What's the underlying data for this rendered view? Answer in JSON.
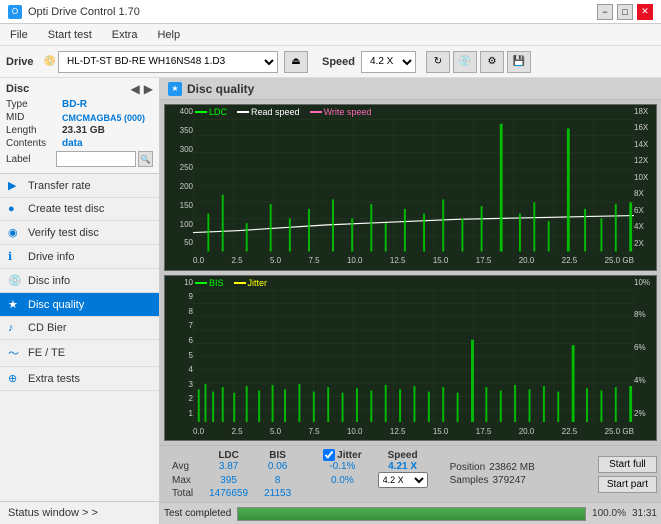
{
  "app": {
    "title": "Opti Drive Control 1.70",
    "icon": "O"
  },
  "titlebar": {
    "minimize_label": "−",
    "maximize_label": "□",
    "close_label": "✕"
  },
  "menubar": {
    "items": [
      "File",
      "Start test",
      "Extra",
      "Help"
    ]
  },
  "drivebar": {
    "drive_label": "Drive",
    "drive_value": "(G:) HL-DT-ST BD-RE  WH16NS48 1.D3",
    "speed_label": "Speed",
    "speed_value": "4.2 X"
  },
  "disc": {
    "section_label": "Disc",
    "type_label": "Type",
    "type_value": "BD-R",
    "mid_label": "MID",
    "mid_value": "CMCMAGBA5 (000)",
    "length_label": "Length",
    "length_value": "23.31 GB",
    "contents_label": "Contents",
    "contents_value": "data",
    "label_label": "Label",
    "label_placeholder": ""
  },
  "nav": {
    "items": [
      {
        "id": "transfer-rate",
        "label": "Transfer rate",
        "icon": "▶"
      },
      {
        "id": "create-test-disc",
        "label": "Create test disc",
        "icon": "●"
      },
      {
        "id": "verify-test-disc",
        "label": "Verify test disc",
        "icon": "◉"
      },
      {
        "id": "drive-info",
        "label": "Drive info",
        "icon": "ℹ"
      },
      {
        "id": "disc-info",
        "label": "Disc info",
        "icon": "💿"
      },
      {
        "id": "disc-quality",
        "label": "Disc quality",
        "icon": "★",
        "active": true
      },
      {
        "id": "cd-bier",
        "label": "CD Bier",
        "icon": "🎵"
      },
      {
        "id": "fe-te",
        "label": "FE / TE",
        "icon": "〜"
      },
      {
        "id": "extra-tests",
        "label": "Extra tests",
        "icon": "⊕"
      }
    ]
  },
  "status_window": {
    "label": "Status window > >"
  },
  "disc_quality": {
    "title": "Disc quality",
    "chart1": {
      "legend": [
        {
          "label": "LDC",
          "color": "#00ff00"
        },
        {
          "label": "Read speed",
          "color": "#ffffff"
        },
        {
          "label": "Write speed",
          "color": "#ff69b4"
        }
      ],
      "y_axis_left": [
        "400",
        "350",
        "300",
        "250",
        "200",
        "150",
        "100",
        "50"
      ],
      "y_axis_right": [
        "18X",
        "16X",
        "14X",
        "12X",
        "10X",
        "8X",
        "6X",
        "4X",
        "2X"
      ],
      "x_axis": [
        "0.0",
        "2.5",
        "5.0",
        "7.5",
        "10.0",
        "12.5",
        "15.0",
        "17.5",
        "20.0",
        "22.5",
        "25.0 GB"
      ]
    },
    "chart2": {
      "legend": [
        {
          "label": "BIS",
          "color": "#00ff00"
        },
        {
          "label": "Jitter",
          "color": "#ffff00"
        }
      ],
      "y_axis_left": [
        "10",
        "9",
        "8",
        "7",
        "6",
        "5",
        "4",
        "3",
        "2",
        "1"
      ],
      "y_axis_right": [
        "10%",
        "8%",
        "6%",
        "4%",
        "2%"
      ],
      "x_axis": [
        "0.0",
        "2.5",
        "5.0",
        "7.5",
        "10.0",
        "12.5",
        "15.0",
        "17.5",
        "20.0",
        "22.5",
        "25.0 GB"
      ]
    },
    "stats": {
      "headers": [
        "LDC",
        "BIS",
        "",
        "Jitter",
        "Speed"
      ],
      "avg_label": "Avg",
      "avg_ldc": "3.87",
      "avg_bis": "0.06",
      "avg_jitter": "-0.1%",
      "max_label": "Max",
      "max_ldc": "395",
      "max_bis": "8",
      "max_jitter": "0.0%",
      "total_label": "Total",
      "total_ldc": "1476659",
      "total_bis": "21153",
      "speed_label": "Speed",
      "speed_value": "4.21 X",
      "speed_select": "4.2 X",
      "position_label": "Position",
      "position_value": "23862 MB",
      "samples_label": "Samples",
      "samples_value": "379247",
      "jitter_checked": true,
      "jitter_label": "Jitter"
    },
    "buttons": {
      "start_full": "Start full",
      "start_part": "Start part"
    },
    "progress": {
      "percent": 100,
      "percent_label": "100.0%",
      "status": "Test completed",
      "time": "31:31"
    }
  }
}
